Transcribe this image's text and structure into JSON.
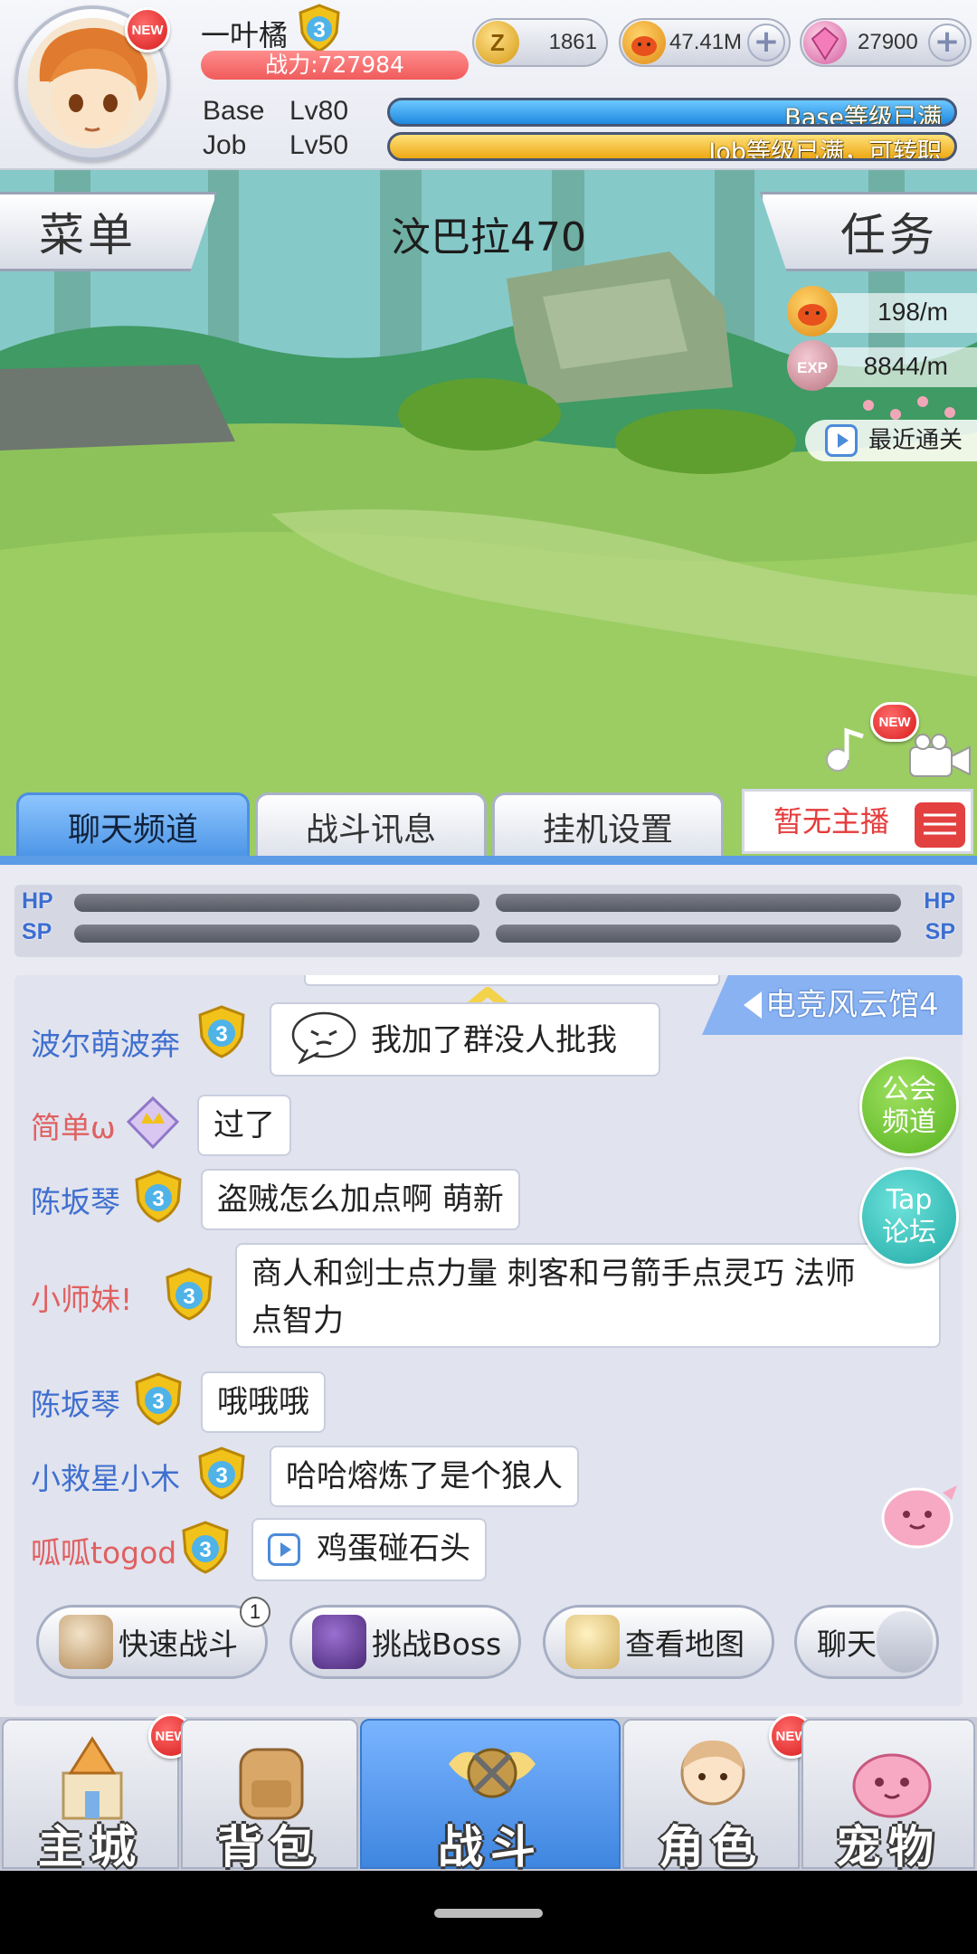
{
  "player": {
    "name": "一叶橘",
    "vip_level": "3",
    "power": "战力:727984",
    "new_badge": "NEW"
  },
  "currencies": [
    {
      "icon": "zeny-coin-icon",
      "value": "1861"
    },
    {
      "icon": "poring-coin-icon",
      "value": "47.41M"
    },
    {
      "icon": "pink-crystal-icon",
      "value": "27900"
    }
  ],
  "levels": {
    "base_label": "Base",
    "base_level": "Lv80",
    "base_status": "Base等级已满",
    "job_label": "Job",
    "job_level": "Lv50",
    "job_status": "Job等级已满，可转职",
    "base_progress": 1.0,
    "job_progress": 1.0
  },
  "scene": {
    "menu_label": "菜单",
    "map_title": "汶巴拉470",
    "task_label": "任务",
    "zeny_rate": "198/m",
    "exp_rate": "8844/m",
    "exp_icon_text": "EXP",
    "recent_clear": "最近通关",
    "new_badge": "NEW"
  },
  "tabs": [
    {
      "label": "聊天频道",
      "active": true
    },
    {
      "label": "战斗讯息",
      "active": false
    },
    {
      "label": "挂机设置",
      "active": false
    }
  ],
  "live": {
    "label": "暂无主播"
  },
  "stats": {
    "hp": "HP",
    "sp": "SP"
  },
  "chat": {
    "channel": "电竞风云馆4",
    "messages": [
      {
        "name": "波尔萌波奔",
        "name_color": "#3f6fcf",
        "badge": "3",
        "text": "我加了群没人批我",
        "emoji": true
      },
      {
        "name": "简单ω",
        "name_color": "#e06060",
        "badge": "",
        "text": "过了"
      },
      {
        "name": "陈坂琴",
        "name_color": "#3f6fcf",
        "badge": "3",
        "text": "盗贼怎么加点啊 萌新"
      },
      {
        "name": "小师妹!",
        "name_color": "#e06060",
        "badge": "3",
        "text_line1": "商人和剑士点力量 刺客和弓箭手点灵巧 法师",
        "text_line2": "点智力"
      },
      {
        "name": "陈坂琴",
        "name_color": "#3f6fcf",
        "badge": "3",
        "text": "哦哦哦"
      },
      {
        "name": "小救星小木",
        "name_color": "#3f6fcf",
        "badge": "3",
        "text": "哈哈熔炼了是个狼人"
      },
      {
        "name": "呱呱togod",
        "name_color": "#e06060",
        "badge": "3",
        "text": "鸡蛋碰石头",
        "voice": true
      }
    ],
    "guild_channel": "公会\n频道",
    "guild_line1": "公会",
    "guild_line2": "频道",
    "tap_line1": "Tap",
    "tap_line2": "论坛"
  },
  "actions": [
    {
      "label": "快速战斗",
      "count": "1"
    },
    {
      "label": "挑战Boss"
    },
    {
      "label": "查看地图"
    },
    {
      "label": "聊天"
    }
  ],
  "nav": [
    {
      "label": "主城",
      "new": true,
      "active": false
    },
    {
      "label": "背包",
      "new": false,
      "active": false
    },
    {
      "label": "战斗",
      "new": false,
      "active": true
    },
    {
      "label": "角色",
      "new": true,
      "active": false
    },
    {
      "label": "宠物",
      "new": false,
      "active": false
    }
  ],
  "colors": {
    "accent_blue": "#4b95e6",
    "base_bar": "#2e9df0",
    "job_bar": "#f5b51c",
    "power_red": "#f05b5b",
    "badge_red": "#d81c1c"
  }
}
